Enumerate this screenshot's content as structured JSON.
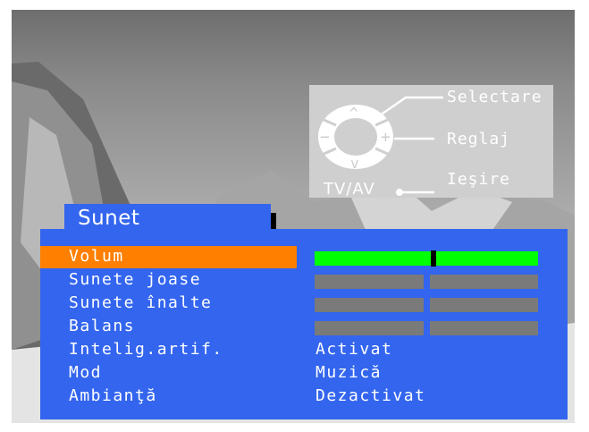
{
  "help": {
    "select_label": "Selectare",
    "adjust_label": "Reglaj",
    "exit_label": "Ieşire",
    "source_label": "TV/AV",
    "up_symbol": "^",
    "down_symbol": "v",
    "minus_symbol": "−",
    "plus_symbol": "+"
  },
  "menu": {
    "title": "Sunet",
    "items": [
      {
        "label": "Volum",
        "selected": true,
        "level": 0.53
      },
      {
        "label": "Sunete joase"
      },
      {
        "label": "Sunete înalte"
      },
      {
        "label": "Balans"
      },
      {
        "label": "Intelig.artif.",
        "value": "Activat"
      },
      {
        "label": "Mod",
        "value": "Muzică"
      },
      {
        "label": "Ambianţă",
        "value": "Dezactivat"
      }
    ]
  },
  "colors": {
    "menu_bg": "#3365ee",
    "highlight": "#ff7f00",
    "volume_bar": "#00ff00",
    "inactive_bar": "#7a7a7a"
  }
}
